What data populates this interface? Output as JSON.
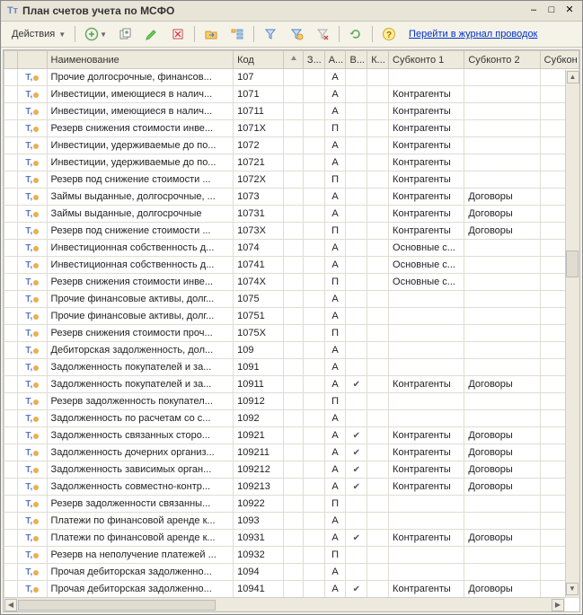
{
  "window": {
    "title": "План счетов учета по МСФО"
  },
  "toolbar": {
    "actions_label": "Действия",
    "journal_link": "Перейти в журнал проводок"
  },
  "columns": {
    "name": "Наименование",
    "code": "Код",
    "z": "З...",
    "a": "А...",
    "b": "В...",
    "k": "К...",
    "s1": "Субконто 1",
    "s2": "Субконто 2",
    "s3": "Субкон"
  },
  "rows": [
    {
      "name": "Прочие долгосрочные, финансов...",
      "code": "107",
      "a": "А",
      "b": "",
      "s1": "",
      "s2": ""
    },
    {
      "name": "Инвестиции, имеющиеся в налич...",
      "code": "1071",
      "a": "А",
      "b": "",
      "s1": "Контрагенты",
      "s2": ""
    },
    {
      "name": "Инвестиции, имеющиеся в налич...",
      "code": "10711",
      "a": "А",
      "b": "",
      "s1": "Контрагенты",
      "s2": ""
    },
    {
      "name": "Резерв снижения стоимости инве...",
      "code": "1071X",
      "a": "П",
      "b": "",
      "s1": "Контрагенты",
      "s2": ""
    },
    {
      "name": "Инвестиции, удерживаемые до по...",
      "code": "1072",
      "a": "А",
      "b": "",
      "s1": "Контрагенты",
      "s2": ""
    },
    {
      "name": "Инвестиции, удерживаемые до по...",
      "code": "10721",
      "a": "А",
      "b": "",
      "s1": "Контрагенты",
      "s2": ""
    },
    {
      "name": "Резерв под снижение стоимости ...",
      "code": "1072X",
      "a": "П",
      "b": "",
      "s1": "Контрагенты",
      "s2": ""
    },
    {
      "name": "Займы выданные, долгосрочные, ...",
      "code": "1073",
      "a": "А",
      "b": "",
      "s1": "Контрагенты",
      "s2": "Договоры"
    },
    {
      "name": "Займы выданные, долгосрочные",
      "code": "10731",
      "a": "А",
      "b": "",
      "s1": "Контрагенты",
      "s2": "Договоры"
    },
    {
      "name": "Резерв под снижение стоимости ...",
      "code": "1073X",
      "a": "П",
      "b": "",
      "s1": "Контрагенты",
      "s2": "Договоры"
    },
    {
      "name": "Инвестиционная собственность д...",
      "code": "1074",
      "a": "А",
      "b": "",
      "s1": "Основные с...",
      "s2": ""
    },
    {
      "name": "Инвестиционная собственность д...",
      "code": "10741",
      "a": "А",
      "b": "",
      "s1": "Основные с...",
      "s2": ""
    },
    {
      "name": "Резерв снижения стоимости инве...",
      "code": "1074X",
      "a": "П",
      "b": "",
      "s1": "Основные с...",
      "s2": ""
    },
    {
      "name": "Прочие финансовые активы, долг...",
      "code": "1075",
      "a": "А",
      "b": "",
      "s1": "",
      "s2": ""
    },
    {
      "name": "Прочие финансовые активы, долг...",
      "code": "10751",
      "a": "А",
      "b": "",
      "s1": "",
      "s2": ""
    },
    {
      "name": "Резерв снижения стоимости проч...",
      "code": "1075X",
      "a": "П",
      "b": "",
      "s1": "",
      "s2": ""
    },
    {
      "name": "Дебиторская задолженность, дол...",
      "code": "109",
      "a": "А",
      "b": "",
      "s1": "",
      "s2": ""
    },
    {
      "name": "Задолженность покупателей и за...",
      "code": "1091",
      "a": "А",
      "b": "",
      "s1": "",
      "s2": ""
    },
    {
      "name": "Задолженность покупателей и за...",
      "code": "10911",
      "a": "А",
      "b": "✔",
      "s1": "Контрагенты",
      "s2": "Договоры"
    },
    {
      "name": "Резерв задолженность покупател...",
      "code": "10912",
      "a": "П",
      "b": "",
      "s1": "",
      "s2": ""
    },
    {
      "name": "Задолженность по расчетам со с...",
      "code": "1092",
      "a": "А",
      "b": "",
      "s1": "",
      "s2": ""
    },
    {
      "name": "Задолженность связанных сторо...",
      "code": "10921",
      "a": "А",
      "b": "✔",
      "s1": "Контрагенты",
      "s2": "Договоры"
    },
    {
      "name": "Задолженность дочерних организ...",
      "code": "109211",
      "a": "А",
      "b": "✔",
      "s1": "Контрагенты",
      "s2": "Договоры"
    },
    {
      "name": "Задолженность зависимых орган...",
      "code": "109212",
      "a": "А",
      "b": "✔",
      "s1": "Контрагенты",
      "s2": "Договоры"
    },
    {
      "name": "Задолженность совместно-контр...",
      "code": "109213",
      "a": "А",
      "b": "✔",
      "s1": "Контрагенты",
      "s2": "Договоры"
    },
    {
      "name": "Резерв задолженности связанны...",
      "code": "10922",
      "a": "П",
      "b": "",
      "s1": "",
      "s2": ""
    },
    {
      "name": "Платежи по финансовой аренде к...",
      "code": "1093",
      "a": "А",
      "b": "",
      "s1": "",
      "s2": ""
    },
    {
      "name": "Платежи по финансовой аренде к...",
      "code": "10931",
      "a": "А",
      "b": "✔",
      "s1": "Контрагенты",
      "s2": "Договоры"
    },
    {
      "name": "Резерв на неполучение платежей ...",
      "code": "10932",
      "a": "П",
      "b": "",
      "s1": "",
      "s2": ""
    },
    {
      "name": "Прочая дебиторская задолженно...",
      "code": "1094",
      "a": "А",
      "b": "",
      "s1": "",
      "s2": ""
    },
    {
      "name": "Прочая дебиторская задолженно...",
      "code": "10941",
      "a": "А",
      "b": "✔",
      "s1": "Контрагенты",
      "s2": "Договоры"
    }
  ]
}
